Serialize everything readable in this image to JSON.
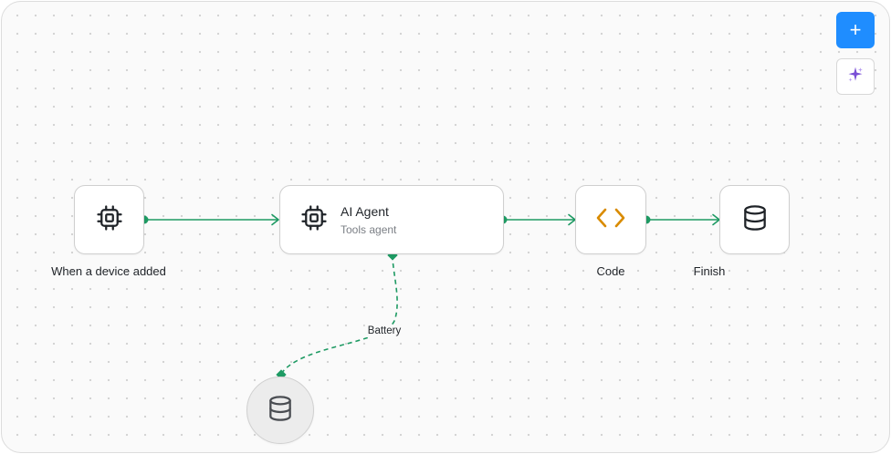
{
  "nodes": {
    "trigger": {
      "label": "When a device added",
      "icon": "chip-icon"
    },
    "agent": {
      "title": "AI Agent",
      "subtitle": "Tools agent",
      "icon": "chip-icon"
    },
    "code": {
      "label": "Code",
      "icon": "code-brackets-icon"
    },
    "finish": {
      "label": "Finish",
      "icon": "database-icon"
    },
    "tool": {
      "icon": "database-icon"
    }
  },
  "edges": {
    "agent_tool_label": "Battery"
  },
  "toolbar": {
    "add_label": "+",
    "ai_icon": "sparkle-icon"
  },
  "colors": {
    "edge": "#1e9a63",
    "accent": "#1f8dff",
    "code_icon": "#d98b00",
    "ai_icon": "#7a4fd6"
  }
}
